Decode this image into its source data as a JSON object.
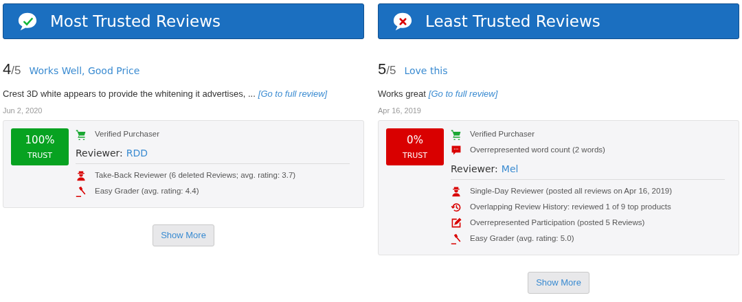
{
  "columns": [
    {
      "header": {
        "kind": "check",
        "title": "Most Trusted Reviews"
      },
      "review": {
        "score": "4",
        "out_of": "/5",
        "title": "Works Well, Good Price",
        "excerpt": "Crest 3D white appears to provide the whitening it advertises, ...",
        "link": "[Go to full review]",
        "date": "Jun 2, 2020"
      },
      "trust": {
        "percent": "100%",
        "label": "TRUST",
        "color": "#07a221"
      },
      "review_flags": [
        {
          "kind": "cart",
          "text": "Verified Purchaser"
        }
      ],
      "reviewer": {
        "label": "Reviewer:",
        "name": "RDD"
      },
      "reviewer_flags": [
        {
          "kind": "person",
          "text": "Take-Back Reviewer (6 deleted Reviews; avg. rating: 3.7)"
        },
        {
          "kind": "gavel",
          "text": "Easy Grader (avg. rating: 4.4)"
        }
      ],
      "button": "Show More"
    },
    {
      "header": {
        "kind": "cross",
        "title": "Least Trusted Reviews"
      },
      "review": {
        "score": "5",
        "out_of": "/5",
        "title": "Love this",
        "excerpt": "Works great",
        "link": "[Go to full review]",
        "date": "Apr 16, 2019"
      },
      "trust": {
        "percent": "0%",
        "label": "TRUST",
        "color": "#d90000"
      },
      "review_flags": [
        {
          "kind": "cart",
          "text": "Verified Purchaser"
        },
        {
          "kind": "comment",
          "text": "Overrepresented word count (2 words)"
        }
      ],
      "reviewer": {
        "label": "Reviewer:",
        "name": "Mel"
      },
      "reviewer_flags": [
        {
          "kind": "person",
          "text": "Single-Day Reviewer (posted all reviews on Apr 16, 2019)"
        },
        {
          "kind": "history",
          "text": "Overlapping Review History: reviewed 1 of 9 top products"
        },
        {
          "kind": "edit",
          "text": "Overrepresented Participation (posted 5 Reviews)"
        },
        {
          "kind": "gavel",
          "text": "Easy Grader (avg. rating: 5.0)"
        }
      ],
      "button": "Show More"
    }
  ]
}
